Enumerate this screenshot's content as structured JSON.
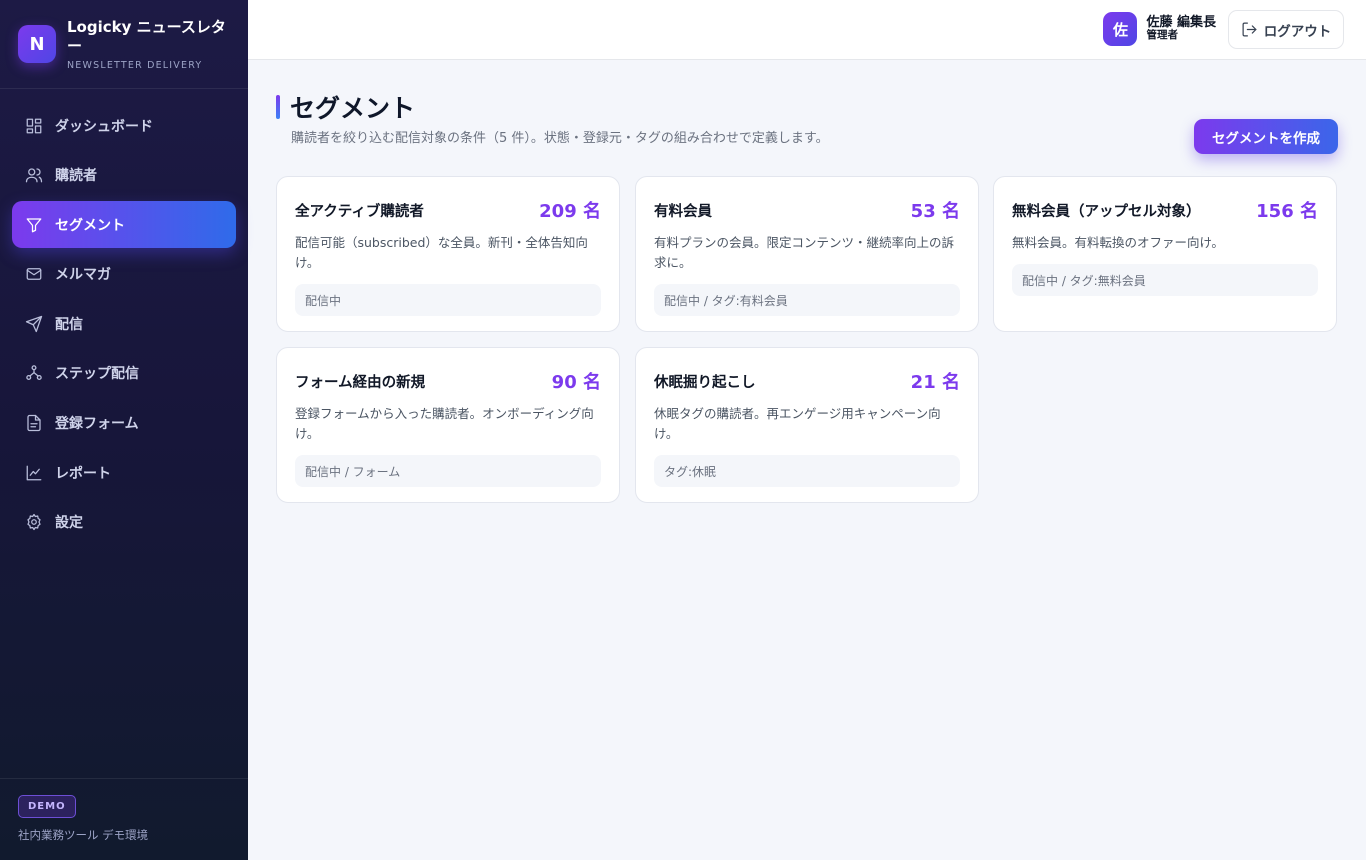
{
  "brand": {
    "logo_letter": "N",
    "title": "Logicky ニュースレター",
    "subtitle": "NEWSLETTER DELIVERY"
  },
  "nav": [
    {
      "icon": "dashboard-icon",
      "label": "ダッシュボード",
      "active": false
    },
    {
      "icon": "users-icon",
      "label": "購読者",
      "active": false
    },
    {
      "icon": "filter-icon",
      "label": "セグメント",
      "active": true
    },
    {
      "icon": "mail-icon",
      "label": "メルマガ",
      "active": false
    },
    {
      "icon": "send-icon",
      "label": "配信",
      "active": false
    },
    {
      "icon": "workflow-icon",
      "label": "ステップ配信",
      "active": false
    },
    {
      "icon": "form-icon",
      "label": "登録フォーム",
      "active": false
    },
    {
      "icon": "report-icon",
      "label": "レポート",
      "active": false
    },
    {
      "icon": "gear-icon",
      "label": "設定",
      "active": false
    }
  ],
  "footer": {
    "badge": "DEMO",
    "note": "社内業務ツール デモ環境"
  },
  "header": {
    "user": {
      "avatar": "佐",
      "name": "佐藤 編集長",
      "role": "管理者"
    },
    "logout_label": "ログアウト"
  },
  "page": {
    "title": "セグメント",
    "description": "購読者を絞り込む配信対象の条件（5 件）。状態・登録元・タグの組み合わせで定義します。",
    "create_button": "セグメントを作成"
  },
  "segments": [
    {
      "name": "全アクティブ購読者",
      "count": "209 名",
      "description": "配信可能（subscribed）な全員。新刊・全体告知向け。",
      "condition": "配信中"
    },
    {
      "name": "有料会員",
      "count": "53 名",
      "description": "有料プランの会員。限定コンテンツ・継続率向上の訴求に。",
      "condition": "配信中 / タグ:有料会員"
    },
    {
      "name": "無料会員（アップセル対象）",
      "count": "156 名",
      "description": "無料会員。有料転換のオファー向け。",
      "condition": "配信中 / タグ:無料会員"
    },
    {
      "name": "フォーム経由の新規",
      "count": "90 名",
      "description": "登録フォームから入った購読者。オンボーディング向け。",
      "condition": "配信中 / フォーム"
    },
    {
      "name": "休眠掘り起こし",
      "count": "21 名",
      "description": "休眠タグの購読者。再エンゲージ用キャンペーン向け。",
      "condition": "タグ:休眠"
    }
  ],
  "colors": {
    "accent": "#7c3aed",
    "accent_blue": "#3b82f6",
    "sidebar_bg": "#1d1a45"
  }
}
